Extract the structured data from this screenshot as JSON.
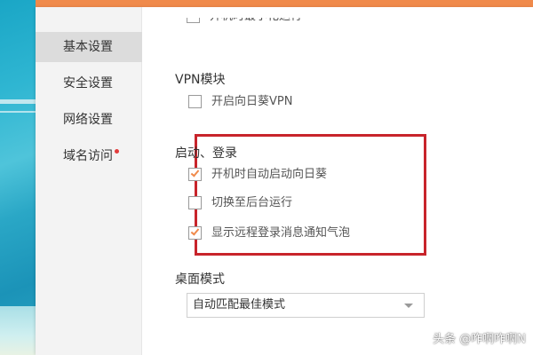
{
  "sidebar": {
    "items": [
      {
        "label": "基本设置",
        "active": true
      },
      {
        "label": "安全设置",
        "active": false
      },
      {
        "label": "网络设置",
        "active": false
      },
      {
        "label": "域名访问",
        "active": false,
        "badge_dot": true
      }
    ]
  },
  "sections": {
    "partial_top": {
      "label": "开机时最小化运行",
      "checked": false
    },
    "vpn": {
      "title": "VPN模块",
      "options": [
        {
          "label": "开启向日葵VPN",
          "checked": false
        }
      ]
    },
    "startup": {
      "title": "启动、登录",
      "options": [
        {
          "label": "开机时自动启动向日葵",
          "checked": true
        },
        {
          "label": "切换至后台运行",
          "checked": false
        },
        {
          "label": "显示远程登录消息通知气泡",
          "checked": true
        }
      ]
    },
    "desktop_mode": {
      "title": "桌面模式",
      "selected": "自动匹配最佳模式"
    }
  },
  "watermark": "头条 @咋啊咋啊N",
  "colors": {
    "accent": "#f08a4b",
    "highlight_border": "#c8242b",
    "sidebar_bg": "#f3f3f3",
    "active_item_bg": "#dcdcdc"
  },
  "icons": {
    "check": "checkmark-icon",
    "dropdown": "chevron-down-icon",
    "badge": "red-dot-icon"
  }
}
